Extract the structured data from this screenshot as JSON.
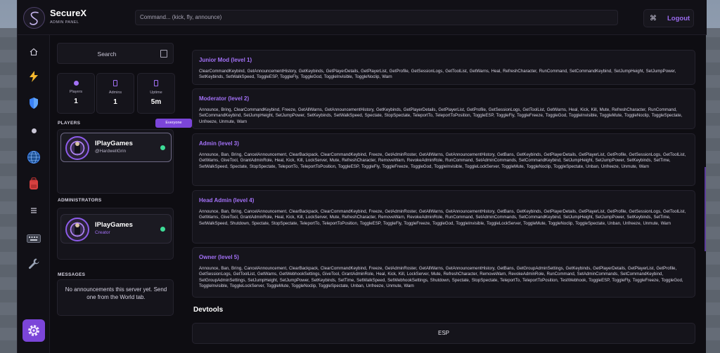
{
  "app": {
    "title": "SecureX",
    "subtitle": "ADMIN PANEL"
  },
  "header": {
    "command_placeholder": "Command... (kick, fly, announce)",
    "logout_label": "Logout"
  },
  "rail": {
    "icons": [
      "home-icon",
      "lightning-icon",
      "shield-icon",
      "dot-icon",
      "globe-icon",
      "backpack-icon",
      "list-icon",
      "keyboard-icon",
      "wrench-icon",
      "gear-icon"
    ]
  },
  "sidebar": {
    "search_label": "Search",
    "stats": [
      {
        "label": "Players",
        "value": "1"
      },
      {
        "label": "Admins",
        "value": "1"
      },
      {
        "label": "Uptime",
        "value": "5m"
      }
    ],
    "players_title": "PLAYERS",
    "filter_label": "Everyone",
    "players": [
      {
        "name": "IPlayGames",
        "handle": "@HardwellGrin"
      }
    ],
    "administrators_title": "ADMINISTRATORS",
    "administrators": [
      {
        "name": "IPlayGames",
        "role": "Creator"
      }
    ],
    "messages_title": "MESSAGES",
    "messages_text": "No announcements this server yet. Send one from the World tab."
  },
  "permissions": [
    {
      "title": "Junior Mod (level 1)",
      "commands": "ClearCommandKeybind, GetAnnouncementHistory, GetKeybinds, GetPlayerDetails, GetPlayerList, GetProfile, GetSessionLogs, GetToolList, GetWarns, Heal, RefreshCharacter, RunCommand, SetCommandKeybind, SetJumpHeight, SetJumpPower, SetKeybinds, SetWalkSpeed, ToggleESP, ToggleFly, ToggleGod, ToggleInvisible, ToggleNoclip, Warn"
    },
    {
      "title": "Moderator (level 2)",
      "commands": "Announce, Bring, ClearCommandKeybind, Freeze, GetAllWarns, GetAnnouncementHistory, GetKeybinds, GetPlayerDetails, GetPlayerList, GetProfile, GetSessionLogs, GetToolList, GetWarns, Heal, Kick, Kill, Mute, RefreshCharacter, RunCommand, SetCommandKeybind, SetJumpHeight, SetJumpPower, SetKeybinds, SetWalkSpeed, Spectate, StopSpectate, TeleportTo, TeleportToPosition, ToggleESP, ToggleFly, ToggleFreeze, ToggleGod, ToggleInvisible, ToggleMute, ToggleNoclip, ToggleSpectate, Unfreeze, Unmute, Warn"
    },
    {
      "title": "Admin (level 3)",
      "commands": "Announce, Ban, Bring, CancelAnnouncement, ClearBackpack, ClearCommandKeybind, Freeze, GetAdminRoster, GetAllWarns, GetAnnouncementHistory, GetBans, GetKeybinds, GetPlayerDetails, GetPlayerList, GetProfile, GetSessionLogs, GetToolList, GetWarns, GiveTool, GrantAdminRole, Heal, Kick, Kill, LockServer, Mute, RefreshCharacter, RemoveWarn, RevokeAdminRole, RunCommand, SetAdminCommands, SetCommandKeybind, SetJumpHeight, SetJumpPower, SetKeybinds, SetTime, SetWalkSpeed, Spectate, StopSpectate, TeleportTo, TeleportToPosition, ToggleESP, ToggleFly, ToggleFreeze, ToggleGod, ToggleInvisible, ToggleLockServer, ToggleMute, ToggleNoclip, ToggleSpectate, Unban, Unfreeze, Unmute, Warn"
    },
    {
      "title": "Head Admin (level 4)",
      "commands": "Announce, Ban, Bring, CancelAnnouncement, ClearBackpack, ClearCommandKeybind, Freeze, GetAdminRoster, GetAllWarns, GetAnnouncementHistory, GetBans, GetKeybinds, GetPlayerDetails, GetPlayerList, GetProfile, GetSessionLogs, GetToolList, GetWarns, GiveTool, GrantAdminRole, Heal, Kick, Kill, LockServer, Mute, RefreshCharacter, RemoveWarn, RevokeAdminRole, RunCommand, SetAdminCommands, SetCommandKeybind, SetJumpHeight, SetJumpPower, SetKeybinds, SetTime, SetWalkSpeed, Shutdown, Spectate, StopSpectate, TeleportTo, TeleportToPosition, ToggleESP, ToggleFly, ToggleFreeze, ToggleGod, ToggleInvisible, ToggleLockServer, ToggleMute, ToggleNoclip, ToggleSpectate, Unban, Unfreeze, Unmute, Warn"
    },
    {
      "title": "Owner (level 5)",
      "commands": "Announce, Ban, Bring, CancelAnnouncement, ClearBackpack, ClearCommandKeybind, Freeze, GetAdminRoster, GetAllWarns, GetAnnouncementHistory, GetBans, GetGroupAdminSettings, GetKeybinds, GetPlayerDetails, GetPlayerList, GetProfile, GetSessionLogs, GetToolList, GetWarns, GetWebhookSettings, GiveTool, GrantAdminRole, Heal, Kick, Kill, LockServer, Mute, RefreshCharacter, RemoveWarn, RevokeAdminRole, RunCommand, SetAdminCommands, SetCommandKeybind, SetGroupAdminSettings, SetJumpHeight, SetJumpPower, SetKeybinds, SetTime, SetWalkSpeed, SetWebhookSettings, Shutdown, Spectate, StopSpectate, TeleportTo, TeleportToPosition, TestWebhook, ToggleESP, ToggleFly, ToggleFreeze, ToggleGod, ToggleInvisible, ToggleLockServer, ToggleMute, ToggleNoclip, ToggleSpectate, Unban, Unfreeze, Unmute, Warn"
    }
  ],
  "devtools": {
    "title": "Devtools",
    "esp_label": "ESP"
  },
  "colors": {
    "accent": "#7b45d9",
    "accent_text": "#a371f7",
    "online": "#3ddc97",
    "panel_bg": "#0e0d12"
  }
}
